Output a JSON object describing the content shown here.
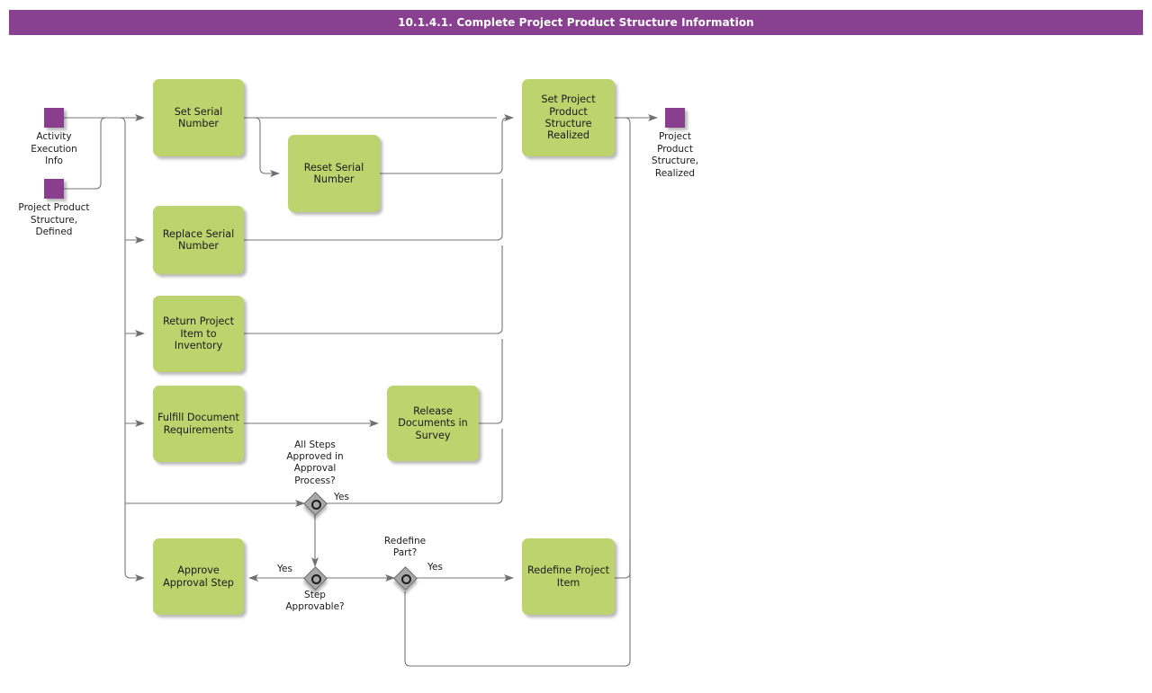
{
  "header": {
    "title": "10.1.4.1. Complete Project Product Structure Information",
    "bg_color": "#8a4090",
    "text_color": "#ffffff"
  },
  "theme": {
    "activity_fill": "#bcd36e",
    "terminal_fill": "#8a3e8e",
    "decision_fill": "#a8a8a8",
    "edge_color": "#707070",
    "text_color": "#1a1a1a"
  },
  "diagram": {
    "start_nodes": [
      {
        "id": "activity-execution-info",
        "label": "Activity\nExecution\nInfo"
      },
      {
        "id": "project-product-structure-defined",
        "label": "Project Product\nStructure,\nDefined"
      }
    ],
    "end_nodes": [
      {
        "id": "project-product-structure-realized",
        "label": "Project\nProduct\nStructure,\nRealized"
      }
    ],
    "activities": [
      {
        "id": "set-serial-number",
        "label": "Set Serial\nNumber"
      },
      {
        "id": "reset-serial-number",
        "label": "Reset Serial\nNumber"
      },
      {
        "id": "replace-serial-number",
        "label": "Replace Serial\nNumber"
      },
      {
        "id": "return-project-item-to-inventory",
        "label": "Return Project\nItem to\nInventory"
      },
      {
        "id": "fulfill-document-requirements",
        "label": "Fulfill Document\nRequirements"
      },
      {
        "id": "release-documents-in-survey",
        "label": "Release\nDocuments in\nSurvey"
      },
      {
        "id": "approve-approval-step",
        "label": "Approve\nApproval Step"
      },
      {
        "id": "redefine-project-item",
        "label": "Redefine Project\nItem"
      },
      {
        "id": "set-project-product-structure-realized",
        "label": "Set Project\nProduct\nStructure\nRealized"
      }
    ],
    "decisions": [
      {
        "id": "all-steps-approved",
        "label": "All Steps\nApproved in\nApproval\nProcess?"
      },
      {
        "id": "step-approvable",
        "label": "Step\nApprovable?"
      },
      {
        "id": "redefine-part",
        "label": "Redefine\nPart?"
      }
    ],
    "edge_labels": [
      {
        "id": "all-steps-approved-yes",
        "label": "Yes"
      },
      {
        "id": "step-approvable-yes",
        "label": "Yes"
      },
      {
        "id": "redefine-part-yes",
        "label": "Yes"
      }
    ]
  }
}
